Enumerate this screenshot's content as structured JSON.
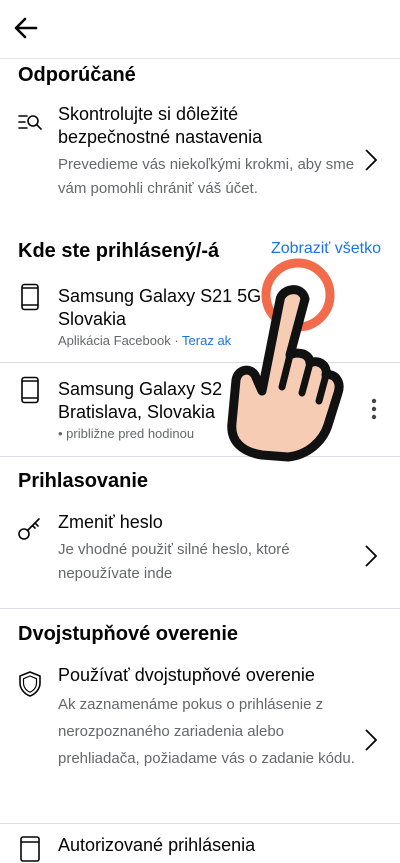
{
  "topbar": {
    "back_icon": "arrow-left-icon"
  },
  "recommended": {
    "title": "Odporúčané",
    "item": {
      "icon": "search-list-icon",
      "title": "Skontrolujte si dôležité bezpečnostné nastavenia",
      "desc": "Prevedieme vás niekoľkými krokmi, aby sme vám pomohli chrániť váš účet."
    }
  },
  "logged_in": {
    "title": "Kde ste prihlásený/-á",
    "see_all": "Zobraziť všetko",
    "devices": [
      {
        "icon": "phone-icon",
        "name": "Samsung Galaxy S21 5G",
        "location": "Slovakia",
        "app": "Aplikácia Facebook · ",
        "status": "Teraz ak"
      },
      {
        "icon": "phone-icon",
        "name": "Samsung Galaxy S2",
        "location": "Bratislava, Slovakia",
        "time": " • približne pred hodinou"
      }
    ]
  },
  "login": {
    "title": "Prihlasovanie",
    "item": {
      "icon": "key-icon",
      "title": "Zmeniť heslo",
      "desc": "Je vhodné použiť silné heslo, ktoré nepoužívate inde"
    }
  },
  "two_factor": {
    "title": "Dvojstupňové overenie",
    "item": {
      "icon": "shield-icon",
      "title": "Používať dvojstupňové overenie",
      "desc": "Ak zaznamenáme pokus o prihlásenie z nerozpoznaného zariadenia alebo prehliadača, požiadame vás o zadanie kódu."
    },
    "next_item": {
      "icon": "authorized-login-icon",
      "title": "Autorizované prihlásenia"
    }
  },
  "colors": {
    "accent": "#1b74e4",
    "secondary_text": "#65676b",
    "tap_indicator": "#f26b4b"
  }
}
